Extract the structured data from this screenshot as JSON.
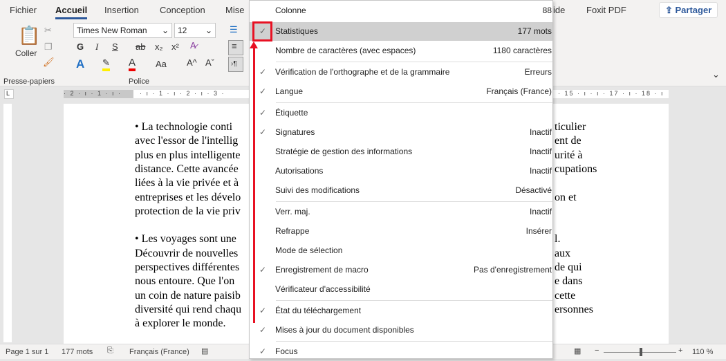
{
  "tabs": [
    "Fichier",
    "Accueil",
    "Insertion",
    "Conception",
    "Mise",
    "ide",
    "Foxit PDF"
  ],
  "share_label": "Partager",
  "ribbon": {
    "paste_label": "Coller",
    "font_name": "Times New Roman",
    "font_size": "12",
    "groups": [
      "Presse-papiers",
      "Police"
    ],
    "buttons": [
      "G",
      "I",
      "S",
      "ab",
      "x₂",
      "x²",
      "Aa",
      "A^",
      "Aˇ"
    ]
  },
  "ruler": {
    "left": "· 2 · ı · 1 · ı ·",
    "mid": "· ı · 1 · ı · 2 · ı · 3 ·",
    "right": "· 15 · ı · ı · 17 · ı · 18 · ı"
  },
  "document": {
    "left": [
      "• La technologie conti",
      "avec l'essor de l'intellig",
      "plus en plus intelligente",
      "distance. Cette avancée",
      "liées à la vie privée et à",
      "entreprises et les dévelo",
      "protection de la vie priv",
      "",
      "• Les voyages sont une",
      "Découvrir de nouvelles",
      "perspectives différentes",
      "nous entoure. Que l'on",
      "un coin de nature paisib",
      "diversité qui rend chaqu",
      "à explorer le monde."
    ],
    "right": [
      "ticulier",
      "ent de",
      "urité à",
      "cupations",
      "",
      "on et",
      "",
      "",
      "l.",
      "aux",
      "de qui",
      "e dans",
      "cette",
      "ersonnes",
      ""
    ]
  },
  "status": {
    "page": "Page 1 sur 1",
    "words": "177 mots",
    "language": "Français (France)",
    "zoom": "110 %"
  },
  "menu": [
    {
      "label": "Colonne",
      "value": "88",
      "checked": false
    },
    {
      "label": "Statistiques",
      "value": "177 mots",
      "checked": true,
      "highlighted": true
    },
    {
      "label": "Nombre de caractères (avec espaces)",
      "value": "1180 caractères",
      "checked": false
    },
    {
      "label": "Vérification de l'orthographe et de la grammaire",
      "value": "Erreurs",
      "checked": true
    },
    {
      "label": "Langue",
      "value": "Français (France)",
      "checked": true
    },
    {
      "label": "Étiquette",
      "value": "",
      "checked": true
    },
    {
      "label": "Signatures",
      "value": "Inactif",
      "checked": true
    },
    {
      "label": "Stratégie de gestion des informations",
      "value": "Inactif",
      "checked": false
    },
    {
      "label": "Autorisations",
      "value": "Inactif",
      "checked": false
    },
    {
      "label": "Suivi des modifications",
      "value": "Désactivé",
      "checked": false
    },
    {
      "label": "Verr. maj.",
      "value": "Inactif",
      "checked": false
    },
    {
      "label": "Refrappe",
      "value": "Insérer",
      "checked": false
    },
    {
      "label": "Mode de sélection",
      "value": "",
      "checked": false
    },
    {
      "label": "Enregistrement de macro",
      "value": "Pas d'enregistrement",
      "checked": true
    },
    {
      "label": "Vérificateur d'accessibilité",
      "value": "",
      "checked": false
    },
    {
      "label": "État du téléchargement",
      "value": "",
      "checked": true
    },
    {
      "label": "Mises à jour du document disponibles",
      "value": "",
      "checked": true
    },
    {
      "label": "Focus",
      "value": "",
      "checked": true
    }
  ],
  "annotation_color": "#e81123"
}
